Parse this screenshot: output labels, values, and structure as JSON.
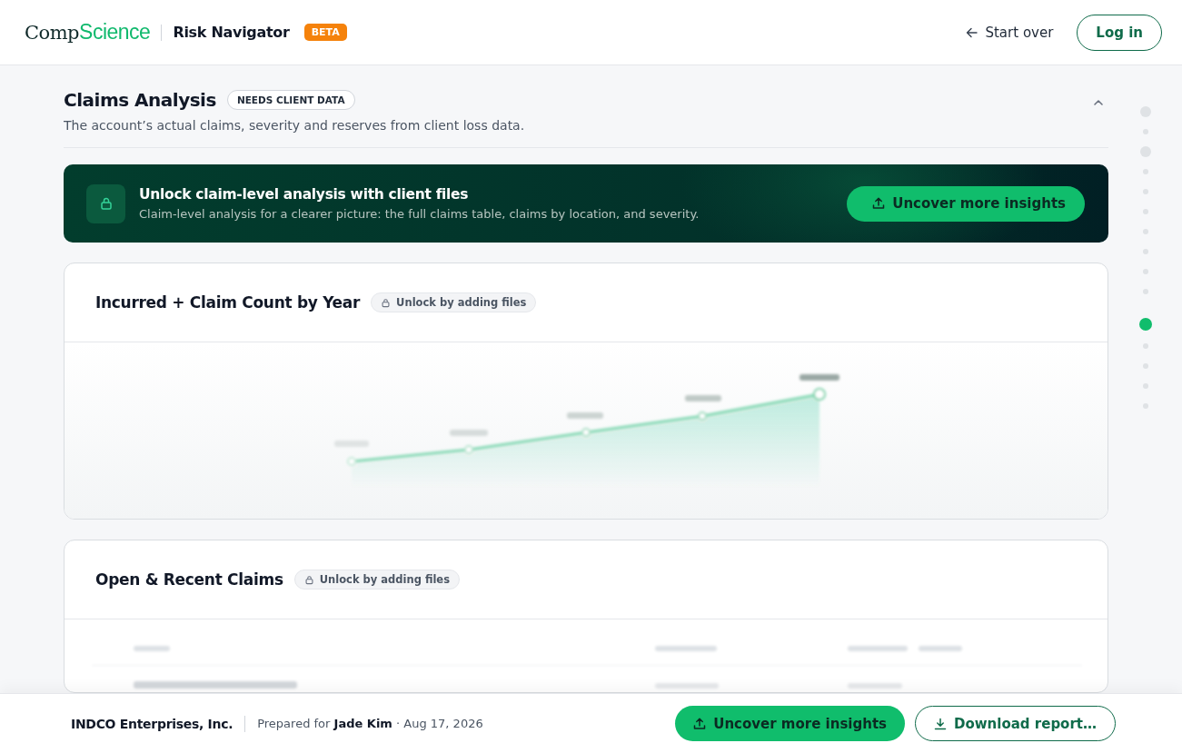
{
  "header": {
    "logo": {
      "part_1": "Comp",
      "part_2": "Science"
    },
    "product": "Risk Navigator",
    "badge": "BETA",
    "start_over": "Start over",
    "login": "Log in"
  },
  "section": {
    "title": "Claims Analysis",
    "badge": "NEEDS CLIENT DATA",
    "subtitle": "The account’s actual claims, severity and reserves from client loss data.",
    "expanded": true
  },
  "banner": {
    "title": "Unlock claim-level analysis with client files",
    "text": "Claim-level analysis for a clearer picture: the full claims table, claims by location, and severity.",
    "button": "Uncover more insights"
  },
  "cards": [
    {
      "kind": "chart",
      "title": "Incurred + Claim Count by Year",
      "lock_label": "Unlock by adding files"
    },
    {
      "kind": "table",
      "title": "Open & Recent Claims",
      "lock_label": "Unlock by adding files"
    }
  ],
  "nav_dots": [
    {
      "kind": "section",
      "selected": false
    },
    {
      "kind": "item",
      "selected": false
    },
    {
      "kind": "section",
      "selected": false
    },
    {
      "kind": "item",
      "selected": false
    },
    {
      "kind": "item",
      "selected": false
    },
    {
      "kind": "item",
      "selected": false
    },
    {
      "kind": "item",
      "selected": false
    },
    {
      "kind": "item",
      "selected": false
    },
    {
      "kind": "item",
      "selected": false
    },
    {
      "kind": "item",
      "selected": false
    },
    {
      "kind": "section",
      "selected": true
    },
    {
      "kind": "item",
      "selected": false
    },
    {
      "kind": "item",
      "selected": false
    },
    {
      "kind": "item",
      "selected": false
    },
    {
      "kind": "item",
      "selected": false
    }
  ],
  "footer": {
    "company": "INDCO Enterprises, Inc.",
    "prepared": "Prepared for **Jade Kim** · Aug 17, 2026",
    "primary_button": "Uncover more insights",
    "secondary_button": "Download report…"
  }
}
